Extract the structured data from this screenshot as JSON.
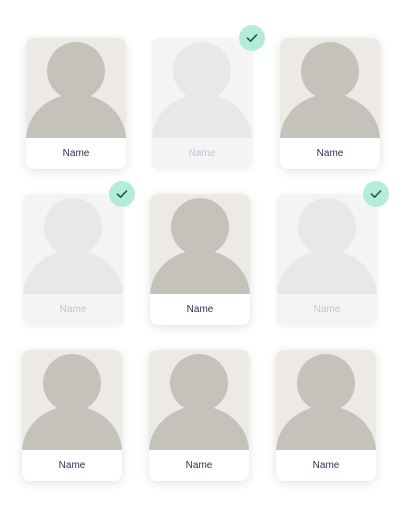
{
  "colors": {
    "photo_bg": "#ede9e4",
    "silhouette": "#c5c1bb",
    "name_text": "#2a3550",
    "selected_name_text": "#c2c6cc",
    "check_bg": "#b4ecdc",
    "check_mark": "#1e5a4c"
  },
  "grid": {
    "cards": [
      {
        "label": "Name",
        "selected": false
      },
      {
        "label": "Name",
        "selected": true
      },
      {
        "label": "Name",
        "selected": false
      },
      {
        "label": "Name",
        "selected": true
      },
      {
        "label": "Name",
        "selected": false
      },
      {
        "label": "Name",
        "selected": true
      },
      {
        "label": "Name",
        "selected": false
      },
      {
        "label": "Name",
        "selected": false
      },
      {
        "label": "Name",
        "selected": false
      }
    ]
  },
  "icons": {
    "avatar": "person-silhouette-icon",
    "check": "checkmark-icon"
  }
}
